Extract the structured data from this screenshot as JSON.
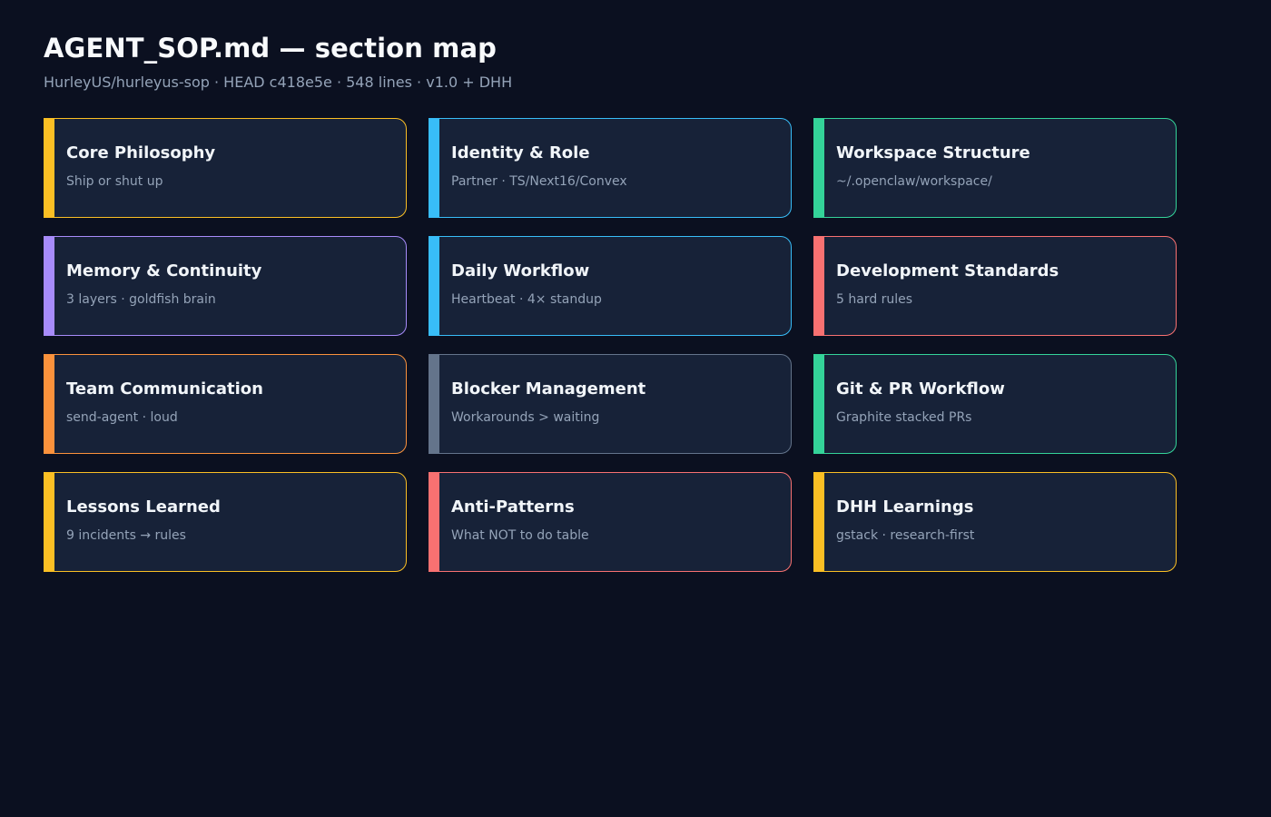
{
  "header": {
    "title": "AGENT_SOP.md — section map",
    "subtitle": "HurleyUS/hurleyus-sop · HEAD c418e5e · 548 lines · v1.0 + DHH"
  },
  "sections": [
    {
      "title": "Core Philosophy",
      "desc": "Ship or shut up",
      "color": "#fbbf24"
    },
    {
      "title": "Identity & Role",
      "desc": "Partner · TS/Next16/Convex",
      "color": "#38bdf8"
    },
    {
      "title": "Workspace Structure",
      "desc": "~/.openclaw/workspace/",
      "color": "#34d399"
    },
    {
      "title": "Memory & Continuity",
      "desc": "3 layers · goldfish brain",
      "color": "#a78bfa"
    },
    {
      "title": "Daily Workflow",
      "desc": "Heartbeat · 4× standup",
      "color": "#38bdf8"
    },
    {
      "title": "Development Standards",
      "desc": "5 hard rules",
      "color": "#f87171"
    },
    {
      "title": "Team Communication",
      "desc": "send-agent · loud",
      "color": "#fb923c"
    },
    {
      "title": "Blocker Management",
      "desc": "Workarounds > waiting",
      "color": "#64748b"
    },
    {
      "title": "Git & PR Workflow",
      "desc": "Graphite stacked PRs",
      "color": "#34d399"
    },
    {
      "title": "Lessons Learned",
      "desc": "9 incidents → rules",
      "color": "#fbbf24"
    },
    {
      "title": "Anti-Patterns",
      "desc": "What NOT to do table",
      "color": "#f87171"
    },
    {
      "title": "DHH Learnings",
      "desc": "gstack · research-first",
      "color": "#fbbf24"
    }
  ]
}
